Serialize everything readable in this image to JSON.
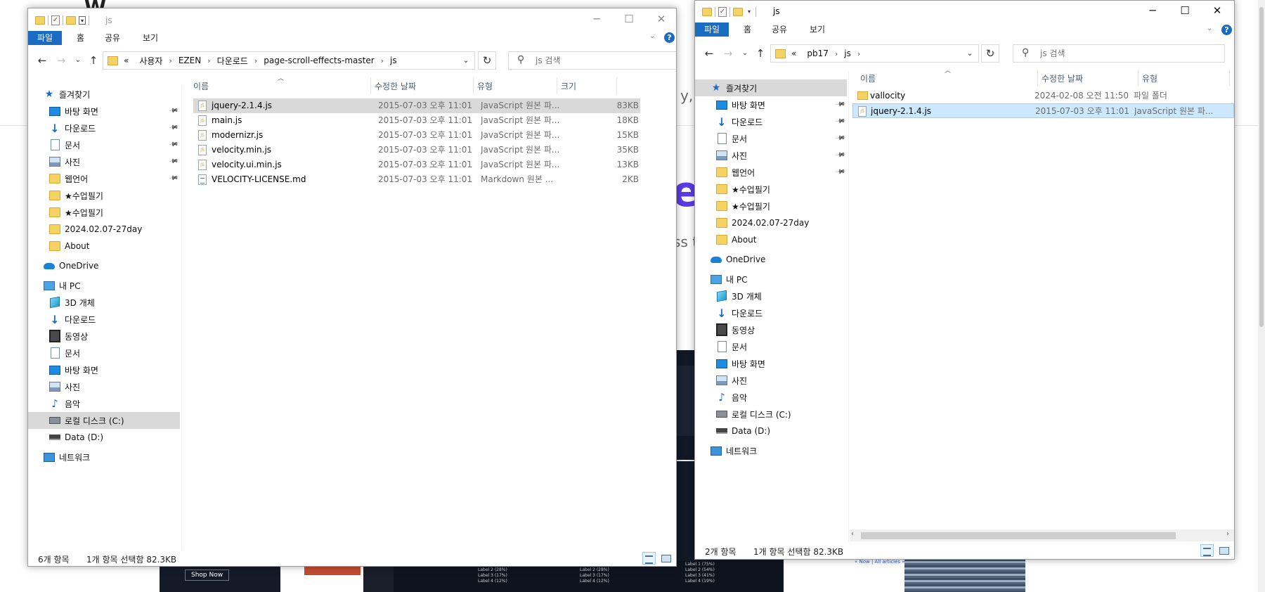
{
  "background": {
    "text1": "y, u",
    "big": "e",
    "text2": "ss t",
    "shop_button": "Shop Now",
    "legend_col1": [
      "Label 2 (28%)",
      "Label 3 (17%)",
      "Label 4 (12%)"
    ],
    "legend_col2": [
      "Label 2 (28%)",
      "Label 3 (17%)",
      "Label 4 (12%)"
    ],
    "legend_col3": [
      "Label 1 (75%)",
      "Label 2 (54%)",
      "Label 3 (41%)",
      "Label 4 (19%)"
    ],
    "links": "« Now | All articles »"
  },
  "left": {
    "title": "js",
    "ribbon": [
      "파일",
      "홈",
      "공유",
      "보기"
    ],
    "breadcrumb": [
      "«",
      "사용자",
      "EZEN",
      "다운로드",
      "page-scroll-effects-master",
      "js"
    ],
    "search_placeholder": "js 검색",
    "nav": [
      {
        "label": "즐겨찾기",
        "icon": "star-icon",
        "indent": 1,
        "pin": false
      },
      {
        "label": "바탕 화면",
        "icon": "desktop-icon",
        "indent": 2,
        "pin": true
      },
      {
        "label": "다운로드",
        "icon": "download-icon",
        "indent": 2,
        "pin": true
      },
      {
        "label": "문서",
        "icon": "document-icon",
        "indent": 2,
        "pin": true
      },
      {
        "label": "사진",
        "icon": "picture-icon",
        "indent": 2,
        "pin": true
      },
      {
        "label": "웹언어",
        "icon": "folder-icon",
        "indent": 2,
        "pin": true
      },
      {
        "label": "★수업필기",
        "icon": "folder-icon",
        "indent": 2,
        "pin": false
      },
      {
        "label": "★수업필기",
        "icon": "folder-icon",
        "indent": 2,
        "pin": false
      },
      {
        "label": "2024.02.07-27day",
        "icon": "folder-icon",
        "indent": 2,
        "pin": false
      },
      {
        "label": "About",
        "icon": "folder-icon",
        "indent": 2,
        "pin": false
      },
      {
        "label": "OneDrive",
        "icon": "onedrive-icon",
        "indent": 1,
        "pin": false,
        "gap": true
      },
      {
        "label": "내 PC",
        "icon": "pc-icon",
        "indent": 1,
        "pin": false,
        "gap": true
      },
      {
        "label": "3D 개체",
        "icon": "cube-icon",
        "indent": 2,
        "pin": false
      },
      {
        "label": "다운로드",
        "icon": "download-icon",
        "indent": 2,
        "pin": false
      },
      {
        "label": "동영상",
        "icon": "video-icon",
        "indent": 2,
        "pin": false
      },
      {
        "label": "문서",
        "icon": "document-icon",
        "indent": 2,
        "pin": false
      },
      {
        "label": "바탕 화면",
        "icon": "desktop-icon",
        "indent": 2,
        "pin": false
      },
      {
        "label": "사진",
        "icon": "picture-icon",
        "indent": 2,
        "pin": false
      },
      {
        "label": "음악",
        "icon": "music-icon",
        "indent": 2,
        "pin": false
      },
      {
        "label": "로컬 디스크 (C:)",
        "icon": "drive-c-icon",
        "indent": 2,
        "pin": false,
        "selected": true
      },
      {
        "label": "Data (D:)",
        "icon": "drive-d-icon",
        "indent": 2,
        "pin": false
      },
      {
        "label": "네트워크",
        "icon": "network-icon",
        "indent": 1,
        "pin": false,
        "gap": true
      }
    ],
    "columns": [
      "이름",
      "수정한 날짜",
      "유형",
      "크기"
    ],
    "files": [
      {
        "name": "jquery-2.1.4.js",
        "date": "2015-07-03 오후 11:01",
        "type": "JavaScript 원본 파...",
        "size": "83KB",
        "icon": "js-file-icon",
        "selected": true
      },
      {
        "name": "main.js",
        "date": "2015-07-03 오후 11:01",
        "type": "JavaScript 원본 파...",
        "size": "18KB",
        "icon": "js-file-icon"
      },
      {
        "name": "modernizr.js",
        "date": "2015-07-03 오후 11:01",
        "type": "JavaScript 원본 파...",
        "size": "15KB",
        "icon": "js-file-icon"
      },
      {
        "name": "velocity.min.js",
        "date": "2015-07-03 오후 11:01",
        "type": "JavaScript 원본 파...",
        "size": "35KB",
        "icon": "js-file-icon"
      },
      {
        "name": "velocity.ui.min.js",
        "date": "2015-07-03 오후 11:01",
        "type": "JavaScript 원본 파...",
        "size": "13KB",
        "icon": "js-file-icon"
      },
      {
        "name": "VELOCITY-LICENSE.md",
        "date": "2015-07-03 오후 11:01",
        "type": "Markdown 원본 ...",
        "size": "2KB",
        "icon": "md-file-icon"
      }
    ],
    "status_count": "6개 항목",
    "status_selected": "1개 항목 선택함 82.3KB"
  },
  "right": {
    "title": "js",
    "ribbon": [
      "파일",
      "홈",
      "공유",
      "보기"
    ],
    "breadcrumb": [
      "«",
      "pb17",
      "js"
    ],
    "search_placeholder": "js 검색",
    "nav": [
      {
        "label": "즐겨찾기",
        "icon": "star-icon",
        "indent": 1,
        "pin": false,
        "selected": true
      },
      {
        "label": "바탕 화면",
        "icon": "desktop-icon",
        "indent": 2,
        "pin": true
      },
      {
        "label": "다운로드",
        "icon": "download-icon",
        "indent": 2,
        "pin": true
      },
      {
        "label": "문서",
        "icon": "document-icon",
        "indent": 2,
        "pin": true
      },
      {
        "label": "사진",
        "icon": "picture-icon",
        "indent": 2,
        "pin": true
      },
      {
        "label": "웹언어",
        "icon": "folder-icon",
        "indent": 2,
        "pin": true
      },
      {
        "label": "★수업필기",
        "icon": "folder-icon",
        "indent": 2,
        "pin": false
      },
      {
        "label": "★수업필기",
        "icon": "folder-icon",
        "indent": 2,
        "pin": false
      },
      {
        "label": "2024.02.07-27day",
        "icon": "folder-icon",
        "indent": 2,
        "pin": false
      },
      {
        "label": "About",
        "icon": "folder-icon",
        "indent": 2,
        "pin": false
      },
      {
        "label": "OneDrive",
        "icon": "onedrive-icon",
        "indent": 1,
        "pin": false,
        "gap": true
      },
      {
        "label": "내 PC",
        "icon": "pc-icon",
        "indent": 1,
        "pin": false,
        "gap": true
      },
      {
        "label": "3D 개체",
        "icon": "cube-icon",
        "indent": 2,
        "pin": false
      },
      {
        "label": "다운로드",
        "icon": "download-icon",
        "indent": 2,
        "pin": false
      },
      {
        "label": "동영상",
        "icon": "video-icon",
        "indent": 2,
        "pin": false
      },
      {
        "label": "문서",
        "icon": "document-icon",
        "indent": 2,
        "pin": false
      },
      {
        "label": "바탕 화면",
        "icon": "desktop-icon",
        "indent": 2,
        "pin": false
      },
      {
        "label": "사진",
        "icon": "picture-icon",
        "indent": 2,
        "pin": false
      },
      {
        "label": "음악",
        "icon": "music-icon",
        "indent": 2,
        "pin": false
      },
      {
        "label": "로컬 디스크 (C:)",
        "icon": "drive-c-icon",
        "indent": 2,
        "pin": false
      },
      {
        "label": "Data (D:)",
        "icon": "drive-d-icon",
        "indent": 2,
        "pin": false
      },
      {
        "label": "네트워크",
        "icon": "network-icon",
        "indent": 1,
        "pin": false,
        "gap": true
      }
    ],
    "columns": [
      "이름",
      "수정한 날짜",
      "유형"
    ],
    "files": [
      {
        "name": "vallocity",
        "date": "2024-02-08 오전 11:50",
        "type": "파일 폴더",
        "icon": "folder-icon"
      },
      {
        "name": "jquery-2.1.4.js",
        "date": "2015-07-03 오후 11:01",
        "type": "JavaScript 원본 파...",
        "icon": "js-file-icon",
        "selected": true
      }
    ],
    "status_count": "2개 항목",
    "status_selected": "1개 항목 선택함 82.3KB"
  }
}
